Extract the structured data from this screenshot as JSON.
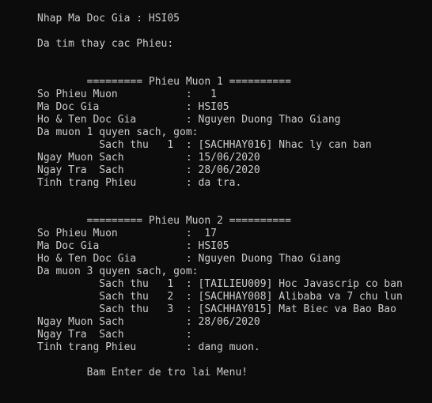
{
  "console": {
    "prompt_line": "Nhap Ma Doc Gia : HSI05",
    "found_line": "Da tim thay cac Phieu:",
    "slips": [
      {
        "header": "        ========= Phieu Muon 1 ==========",
        "slip_number": "So Phieu Muon           :   1",
        "reader_id": "Ma Doc Gia              : HSI05",
        "reader_name": "Ho & Ten Doc Gia        : Nguyen Duong Thao Giang",
        "books_intro": "Da muon 1 quyen sach, gom:",
        "books": [
          "          Sach thu   1  : [SACHHAY016] Nhac ly can ban"
        ],
        "borrow_date": "Ngay Muon Sach          : 15/06/2020",
        "return_date": "Ngay Tra  Sach          : 28/06/2020",
        "status": "Tinh trang Phieu        : da tra."
      },
      {
        "header": "        ========= Phieu Muon 2 ==========",
        "slip_number": "So Phieu Muon           :  17",
        "reader_id": "Ma Doc Gia              : HSI05",
        "reader_name": "Ho & Ten Doc Gia        : Nguyen Duong Thao Giang",
        "books_intro": "Da muon 3 quyen sach, gom:",
        "books": [
          "          Sach thu   1  : [TAILIEU009] Hoc Javascrip co ban",
          "          Sach thu   2  : [SACHHAY008] Alibaba va 7 chu lun",
          "          Sach thu   3  : [SACHHAY015] Mat Biec va Bao Bao"
        ],
        "borrow_date": "Ngay Muon Sach          : 28/06/2020",
        "return_date": "Ngay Tra  Sach          :",
        "status": "Tinh trang Phieu        : dang muon."
      }
    ],
    "footer": "        Bam Enter de tro lai Menu!"
  },
  "colors": {
    "background": "#0c0c0c",
    "text": "#cccccc"
  }
}
